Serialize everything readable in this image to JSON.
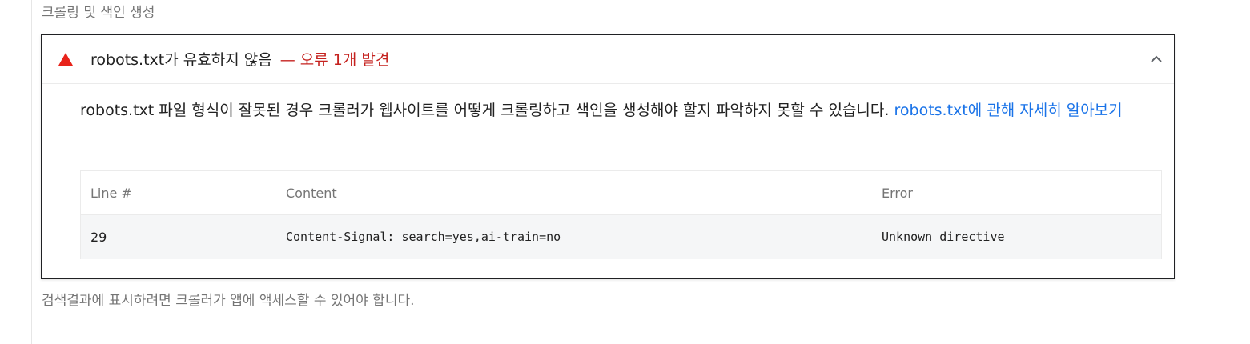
{
  "group": {
    "title": "크롤링 및 색인 생성",
    "footer": "검색결과에 표시하려면 크롤러가 앱에 액세스할 수 있어야 합니다."
  },
  "audit": {
    "title": "robots.txt가 유효하지 않음",
    "error_summary": "— 오류 1개 발견",
    "status_icon": "fail-triangle-icon",
    "status_color": "#e8231a",
    "expanded": true,
    "description": "robots.txt 파일 형식이 잘못된 경우 크롤러가 웹사이트를 어떻게 크롤링하고 색인을 생성해야 할지 파악하지 못할 수 있습니다. ",
    "learn_more": "robots.txt에 관해 자세히 알아보기",
    "link_color": "#1a73e8"
  },
  "table": {
    "columns": [
      "Line #",
      "Content",
      "Error"
    ],
    "rows": [
      {
        "line": "29",
        "content": "Content-Signal: search=yes,ai-train=no",
        "error": "Unknown directive"
      }
    ]
  }
}
